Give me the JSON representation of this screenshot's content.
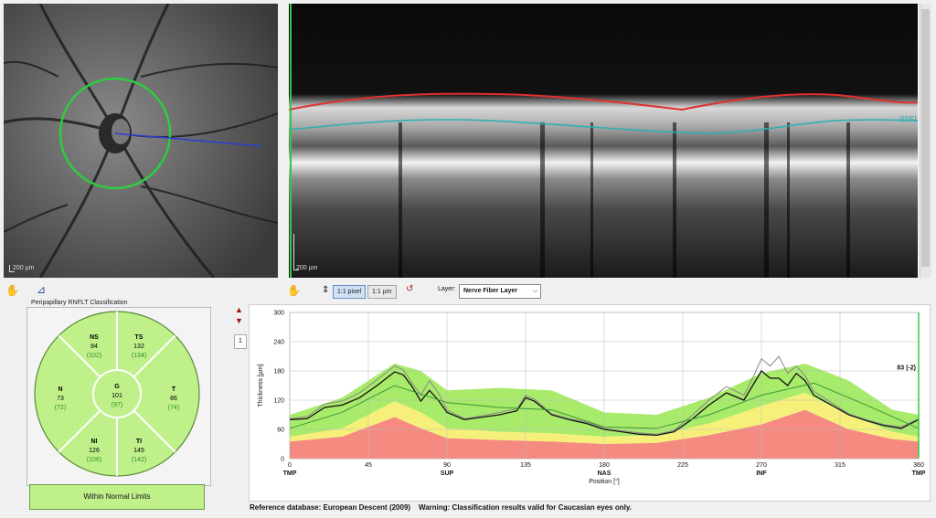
{
  "fundus": {
    "scale_label": "200 µm"
  },
  "bscan": {
    "scale_label": "200 µm",
    "rnfl_label": "RNFL"
  },
  "toolbar": {
    "hand_icon": "hand-icon",
    "measure_icon": "measure-icon",
    "btn_1to1_pixel": "1:1 pixel",
    "btn_1to1_um": "1:1 µm",
    "layer_label": "Layer:",
    "layer_value": "Nerve Fiber Layer"
  },
  "classification": {
    "title": "Peripapillary RNFLT Classification",
    "sectors": {
      "NS": {
        "name": "NS",
        "value": "84",
        "ref": "(102)"
      },
      "TS": {
        "name": "TS",
        "value": "132",
        "ref": "(134)"
      },
      "N": {
        "name": "N",
        "value": "73",
        "ref": "(72)"
      },
      "T": {
        "name": "T",
        "value": "86",
        "ref": "(74)"
      },
      "G": {
        "name": "G",
        "value": "101",
        "ref": "(97)"
      },
      "NI": {
        "name": "NI",
        "value": "126",
        "ref": "(106)"
      },
      "TI": {
        "name": "TI",
        "value": "145",
        "ref": "(142)"
      }
    },
    "result": "Within Normal Limits",
    "colors": {
      "normal": "#bff08a",
      "border": "#5a8a3a",
      "ref_text": "#2f8f2f"
    }
  },
  "pager": {
    "page": "1"
  },
  "chart_data": {
    "type": "line",
    "ylabel": "Thickness [µm]",
    "xlabel": "Position [°]",
    "xlim": [
      0,
      360
    ],
    "ylim": [
      0,
      300
    ],
    "yticks": [
      0,
      60,
      120,
      180,
      240,
      300
    ],
    "xticks": [
      0,
      45,
      90,
      135,
      180,
      225,
      270,
      315,
      360
    ],
    "sector_labels": [
      {
        "x": 0,
        "label": "TMP"
      },
      {
        "x": 90,
        "label": "SUP"
      },
      {
        "x": 180,
        "label": "NAS"
      },
      {
        "x": 270,
        "label": "INF"
      },
      {
        "x": 360,
        "label": "TMP"
      }
    ],
    "cursor_value": "83 (-2)",
    "bands": {
      "x": [
        0,
        30,
        60,
        75,
        90,
        120,
        150,
        180,
        210,
        240,
        270,
        295,
        320,
        345,
        360
      ],
      "red_top": [
        35,
        45,
        85,
        62,
        42,
        38,
        35,
        30,
        32,
        48,
        70,
        100,
        60,
        40,
        35
      ],
      "yellow_top": [
        45,
        62,
        118,
        95,
        62,
        55,
        52,
        45,
        48,
        72,
        108,
        135,
        90,
        55,
        45
      ],
      "green_top": [
        90,
        125,
        195,
        180,
        140,
        145,
        140,
        95,
        90,
        125,
        175,
        195,
        160,
        100,
        90
      ]
    },
    "series": [
      {
        "name": "measured",
        "x": [
          0,
          10,
          20,
          30,
          40,
          50,
          60,
          65,
          70,
          75,
          80,
          85,
          90,
          100,
          110,
          120,
          130,
          135,
          140,
          150,
          160,
          170,
          180,
          190,
          200,
          210,
          220,
          230,
          240,
          250,
          260,
          265,
          270,
          275,
          280,
          285,
          290,
          295,
          300,
          310,
          320,
          330,
          340,
          350,
          360
        ],
        "y": [
          80,
          82,
          105,
          110,
          125,
          150,
          178,
          172,
          148,
          118,
          140,
          120,
          95,
          80,
          85,
          90,
          98,
          125,
          118,
          90,
          80,
          72,
          60,
          55,
          50,
          48,
          55,
          80,
          110,
          135,
          120,
          150,
          180,
          165,
          165,
          150,
          175,
          160,
          130,
          110,
          90,
          78,
          68,
          62,
          80
        ]
      },
      {
        "name": "reference",
        "x": [
          0,
          10,
          20,
          30,
          40,
          50,
          60,
          65,
          70,
          75,
          80,
          85,
          90,
          100,
          110,
          120,
          130,
          135,
          140,
          150,
          160,
          170,
          180,
          190,
          200,
          210,
          220,
          230,
          240,
          250,
          260,
          265,
          270,
          275,
          280,
          285,
          290,
          295,
          300,
          310,
          320,
          330,
          340,
          350,
          360
        ],
        "y": [
          82,
          86,
          112,
          118,
          135,
          162,
          190,
          182,
          155,
          130,
          160,
          135,
          100,
          82,
          88,
          95,
          102,
          130,
          122,
          92,
          82,
          75,
          62,
          57,
          53,
          50,
          58,
          88,
          120,
          148,
          130,
          165,
          205,
          190,
          210,
          175,
          190,
          170,
          138,
          115,
          92,
          80,
          70,
          65,
          82
        ]
      },
      {
        "name": "normative-mean",
        "x": [
          0,
          30,
          60,
          90,
          120,
          150,
          180,
          210,
          240,
          270,
          300,
          330,
          360
        ],
        "y": [
          62,
          95,
          150,
          115,
          105,
          100,
          65,
          62,
          90,
          130,
          155,
          110,
          62
        ]
      }
    ]
  },
  "footer": {
    "reference_db": "Reference database: European Descent (2009)",
    "warning": "Warning: Classification results valid for Caucasian eyes only."
  }
}
